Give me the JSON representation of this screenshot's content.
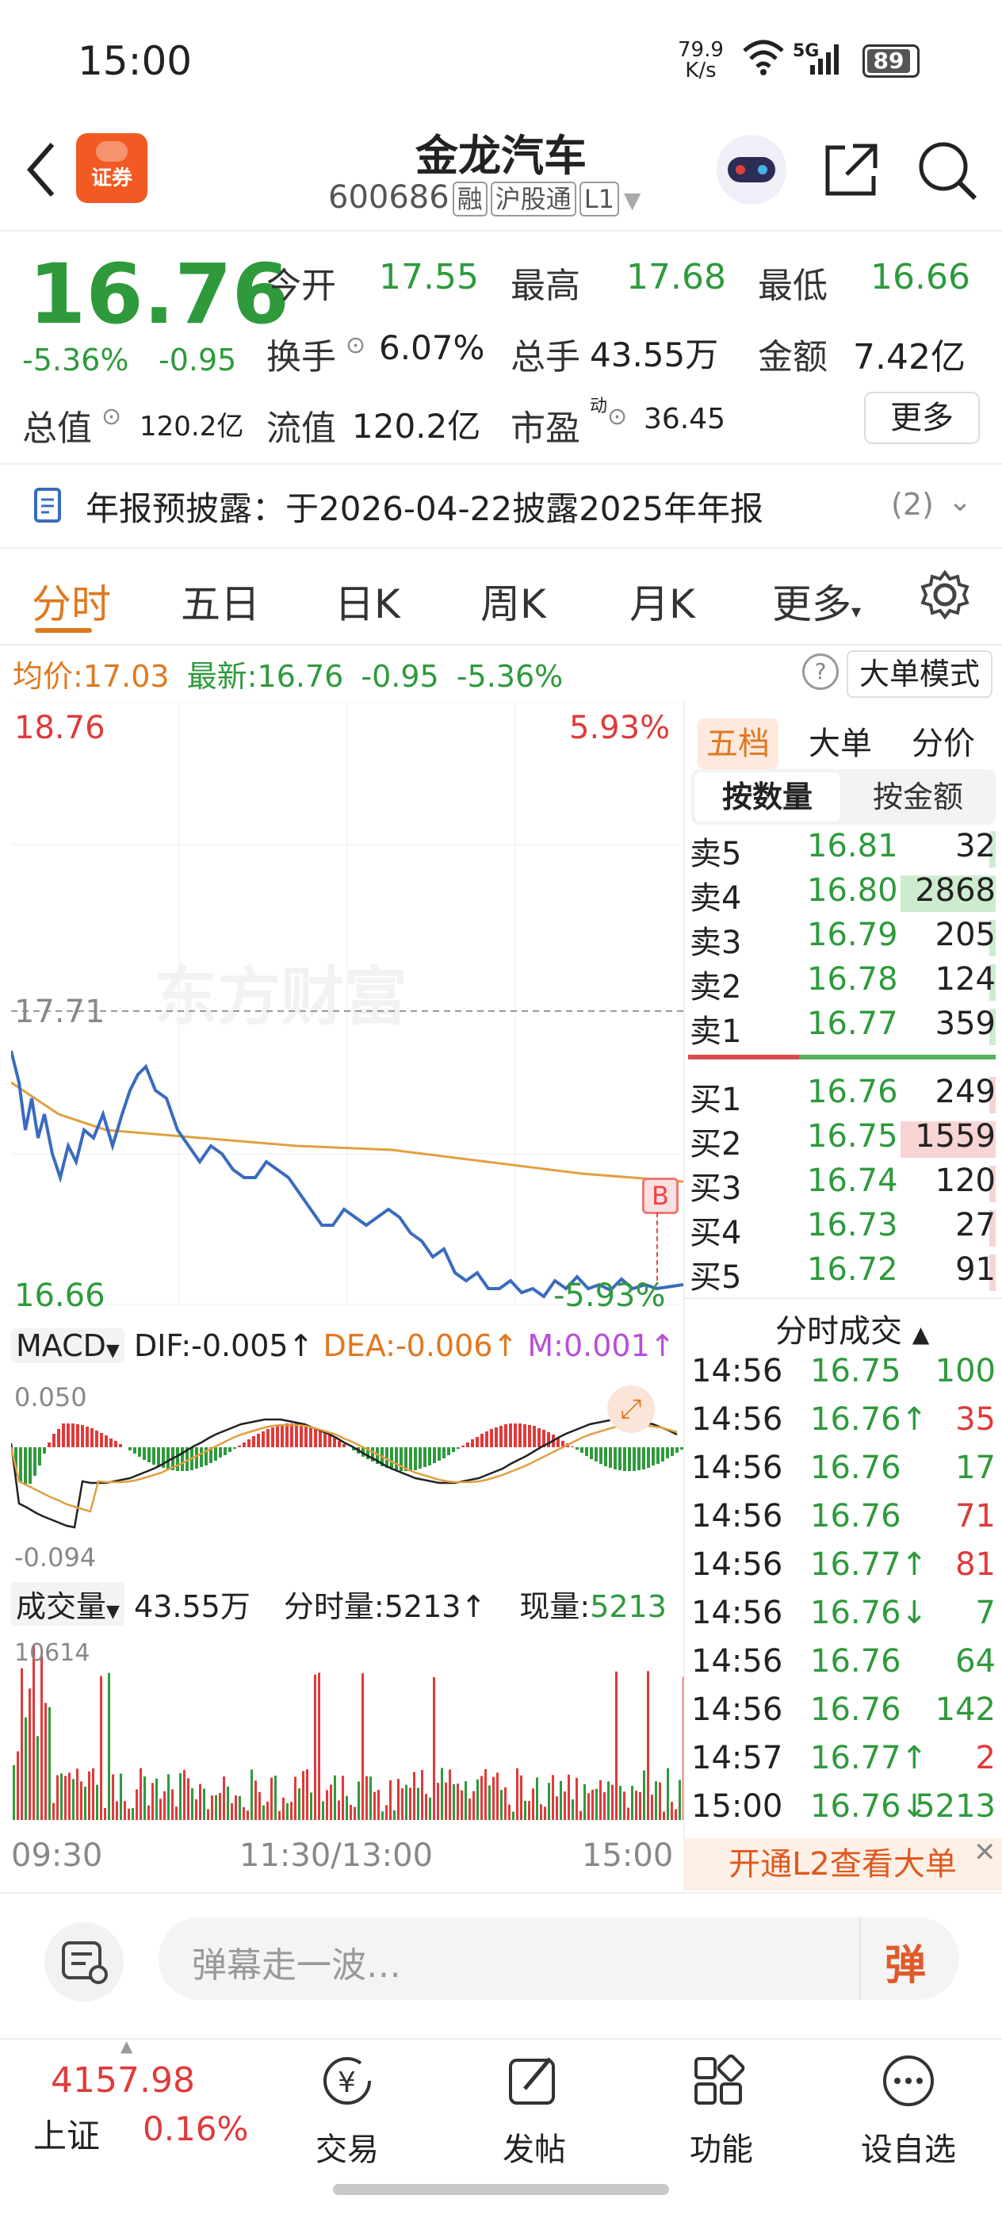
{
  "status": {
    "time": "15:00",
    "net_speed": "79.9",
    "net_unit": "K/s",
    "signal": "5G",
    "battery": "89"
  },
  "header": {
    "title": "金龙汽车",
    "code": "600686",
    "tags": [
      "融",
      "沪股通",
      "L1"
    ],
    "broker_badge": "证券"
  },
  "quote": {
    "price": "16.76",
    "change_pct": "-5.36%",
    "change": "-0.95",
    "open_label": "今开",
    "open": "17.55",
    "high_label": "最高",
    "high": "17.68",
    "low_label": "最低",
    "low": "16.66",
    "turnover_label": "换手",
    "turnover": "6.07%",
    "volume_label": "总手",
    "volume": "43.55万",
    "amount_label": "金额",
    "amount": "7.42亿",
    "mktcap_label": "总值",
    "mktcap": "120.2亿",
    "float_label": "流值",
    "float": "120.2亿",
    "pe_label": "市盈",
    "pe_sup": "动",
    "pe": "36.45",
    "more_label": "更多"
  },
  "notice": {
    "text": "年报预披露：于2026-04-22披露2025年年报",
    "count": "(2)"
  },
  "tabs": [
    "分时",
    "五日",
    "日K",
    "周K",
    "月K",
    "更多"
  ],
  "info": {
    "avg_label": "均价:",
    "avg": "17.03",
    "last_label": "最新:",
    "last": "16.76",
    "chg": "-0.95",
    "pct": "-5.36%",
    "big_mode": "大单模式"
  },
  "chart": {
    "top_price": "18.76",
    "top_pct": "5.93%",
    "mid_price": "17.71",
    "low_price": "16.66",
    "low_pct": "-5.93%",
    "watermark": "东方财富",
    "marker": "B",
    "macd_label": "MACD",
    "dif": "DIF:-0.005↑",
    "dea": "DEA:-0.006↑",
    "m": "M:0.001↑",
    "macd_top": "0.050",
    "macd_bottom": "-0.094",
    "vol_label": "成交量",
    "vol_total": "43.55万",
    "vol_min": "分时量:5213↑",
    "vol_now_label": "现量:",
    "vol_now": "5213",
    "vol_max": "10614",
    "time_start": "09:30",
    "time_mid": "11:30/13:00",
    "time_end": "15:00",
    "colors": {
      "price": "#3a6bbf",
      "avg": "#e0a040",
      "up": "#e03a3a",
      "down": "#2e9a3c"
    }
  },
  "panel": {
    "tabs": [
      "五档",
      "大单",
      "分价"
    ],
    "seg": [
      "按数量",
      "按金额"
    ],
    "asks": [
      {
        "label": "卖5",
        "price": "16.81",
        "vol": "32"
      },
      {
        "label": "卖4",
        "price": "16.80",
        "vol": "2868"
      },
      {
        "label": "卖3",
        "price": "16.79",
        "vol": "205"
      },
      {
        "label": "卖2",
        "price": "16.78",
        "vol": "124"
      },
      {
        "label": "卖1",
        "price": "16.77",
        "vol": "359"
      }
    ],
    "bids": [
      {
        "label": "买1",
        "price": "16.76",
        "vol": "249"
      },
      {
        "label": "买2",
        "price": "16.75",
        "vol": "1559"
      },
      {
        "label": "买3",
        "price": "16.74",
        "vol": "120"
      },
      {
        "label": "买4",
        "price": "16.73",
        "vol": "27"
      },
      {
        "label": "买5",
        "price": "16.72",
        "vol": "91"
      }
    ],
    "ticks_title": "分时成交",
    "ticks": [
      {
        "time": "14:56",
        "price": "16.75",
        "vol": "100",
        "dir": ""
      },
      {
        "time": "14:56",
        "price": "16.76↑",
        "vol": "35",
        "dir": "up"
      },
      {
        "time": "14:56",
        "price": "16.76",
        "vol": "17",
        "dir": ""
      },
      {
        "time": "14:56",
        "price": "16.76",
        "vol": "71",
        "dir": "upv"
      },
      {
        "time": "14:56",
        "price": "16.77↑",
        "vol": "81",
        "dir": "up"
      },
      {
        "time": "14:56",
        "price": "16.76↓",
        "vol": "7",
        "dir": ""
      },
      {
        "time": "14:56",
        "price": "16.76",
        "vol": "64",
        "dir": ""
      },
      {
        "time": "14:56",
        "price": "16.76",
        "vol": "142",
        "dir": ""
      },
      {
        "time": "14:57",
        "price": "16.77↑",
        "vol": "2",
        "dir": "up"
      },
      {
        "time": "15:00",
        "price": "16.76↓",
        "vol": "5213",
        "dir": ""
      }
    ],
    "l2": "开通L2查看大单"
  },
  "comment": {
    "placeholder": "弹幕走一波…",
    "button": "弹"
  },
  "nav": {
    "index_value": "4157.98",
    "index_name": "上证",
    "index_pct": "0.16%",
    "items": [
      "交易",
      "发帖",
      "功能",
      "设自选"
    ]
  }
}
